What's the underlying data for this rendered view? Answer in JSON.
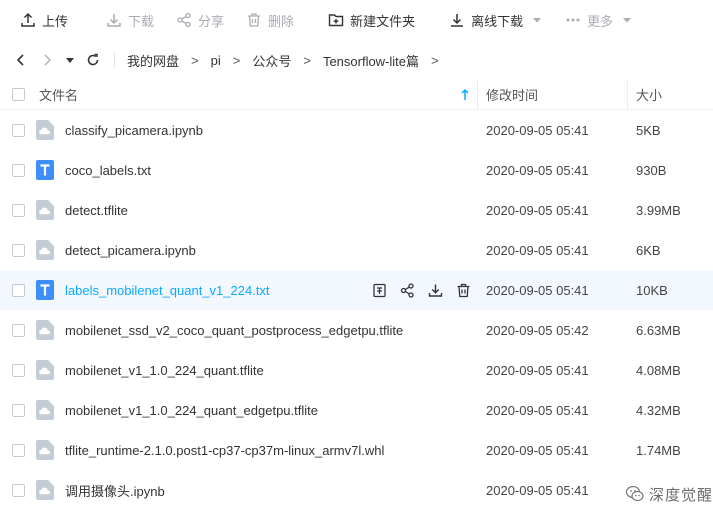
{
  "toolbar": {
    "upload": "上传",
    "download": "下载",
    "share": "分享",
    "delete": "删除",
    "new_folder": "新建文件夹",
    "offline_download": "离线下载",
    "more": "更多"
  },
  "breadcrumb": {
    "items": [
      "我的网盘",
      "pi",
      "公众号",
      "Tensorflow-lite篇"
    ],
    "separator": ">"
  },
  "table": {
    "headers": {
      "name": "文件名",
      "date": "修改时间",
      "size": "大小"
    },
    "rows": [
      {
        "name": "classify_picamera.ipynb",
        "date": "2020-09-05 05:41",
        "size": "5KB",
        "icon": "cloud-file-icon"
      },
      {
        "name": "coco_labels.txt",
        "date": "2020-09-05 05:41",
        "size": "930B",
        "icon": "text-file-icon"
      },
      {
        "name": "detect.tflite",
        "date": "2020-09-05 05:41",
        "size": "3.99MB",
        "icon": "cloud-file-icon"
      },
      {
        "name": "detect_picamera.ipynb",
        "date": "2020-09-05 05:41",
        "size": "6KB",
        "icon": "cloud-file-icon"
      },
      {
        "name": "labels_mobilenet_quant_v1_224.txt",
        "date": "2020-09-05 05:41",
        "size": "10KB",
        "icon": "text-file-icon"
      },
      {
        "name": "mobilenet_ssd_v2_coco_quant_postprocess_edgetpu.tflite",
        "date": "2020-09-05 05:42",
        "size": "6.63MB",
        "icon": "cloud-file-icon"
      },
      {
        "name": "mobilenet_v1_1.0_224_quant.tflite",
        "date": "2020-09-05 05:41",
        "size": "4.08MB",
        "icon": "cloud-file-icon"
      },
      {
        "name": "mobilenet_v1_1.0_224_quant_edgetpu.tflite",
        "date": "2020-09-05 05:41",
        "size": "4.32MB",
        "icon": "cloud-file-icon"
      },
      {
        "name": "tflite_runtime-2.1.0.post1-cp37-cp37m-linux_armv7l.whl",
        "date": "2020-09-05 05:41",
        "size": "1.74MB",
        "icon": "cloud-file-icon"
      },
      {
        "name": "调用摄像头.ipynb",
        "date": "2020-09-05 05:41",
        "size": "",
        "icon": "cloud-file-icon"
      }
    ]
  },
  "watermark": {
    "text": "深度觉醒"
  },
  "colors": {
    "accent": "#09aaff",
    "file_icon_gray": "#c4ccd6",
    "text_icon_blue": "#3d8ef8",
    "hover_row": "#f3f8ff",
    "disabled": "#a9acb3"
  }
}
